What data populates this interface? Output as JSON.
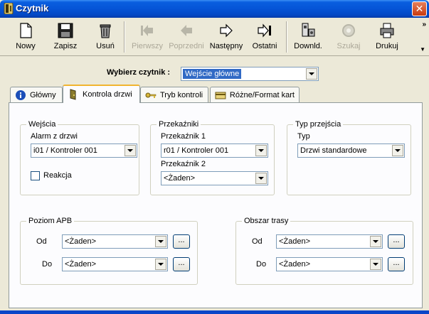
{
  "window": {
    "title": "Czytnik",
    "close_glyph": "✕"
  },
  "toolbar": {
    "buttons": [
      {
        "label": "Nowy",
        "icon": "new-document-icon",
        "enabled": true
      },
      {
        "label": "Zapisz",
        "icon": "floppy-disk-icon",
        "enabled": true
      },
      {
        "label": "Usuń",
        "icon": "trash-can-icon",
        "enabled": true
      },
      {
        "label": "Pierwszy",
        "icon": "first-arrow-icon",
        "enabled": false
      },
      {
        "label": "Poprzedni",
        "icon": "previous-arrow-icon",
        "enabled": false
      },
      {
        "label": "Następny",
        "icon": "next-arrow-icon",
        "enabled": true
      },
      {
        "label": "Ostatni",
        "icon": "last-arrow-icon",
        "enabled": true
      },
      {
        "label": "Downld.",
        "icon": "download-device-icon",
        "enabled": true
      },
      {
        "label": "Szukaj",
        "icon": "search-icon",
        "enabled": false
      },
      {
        "label": "Drukuj",
        "icon": "printer-icon",
        "enabled": true
      }
    ],
    "overflow_glyph": "»",
    "dropdown_glyph": "▼"
  },
  "reader_select": {
    "label": "Wybierz czytnik :",
    "value": "Wejście główne"
  },
  "tabs": [
    {
      "label": "Główny",
      "icon": "info-icon",
      "active": false
    },
    {
      "label": "Kontrola drzwi",
      "icon": "door-icon",
      "active": true
    },
    {
      "label": "Tryb kontroli",
      "icon": "key-icon",
      "active": false
    },
    {
      "label": "Różne/Format kart",
      "icon": "card-reader-icon",
      "active": false
    }
  ],
  "inputs_group": {
    "title": "Wejścia",
    "alarm_label": "Alarm z drzwi",
    "alarm_value": "i01 / Kontroler 001",
    "reaction_label": "Reakcja",
    "reaction_checked": false
  },
  "relays_group": {
    "title": "Przekaźniki",
    "relay1_label": "Przekaźnik 1",
    "relay1_value": "r01 / Kontroler 001",
    "relay2_label": "Przekaźnik 2",
    "relay2_value": "<Żaden>"
  },
  "passage_group": {
    "title": "Typ przejścia",
    "type_label": "Typ",
    "type_value": "Drzwi standardowe"
  },
  "apb_group": {
    "title": "Poziom APB",
    "from_label": "Od",
    "from_value": "<Żaden>",
    "to_label": "Do",
    "to_value": "<Żaden>",
    "browse_label": "..."
  },
  "route_group": {
    "title": "Obszar trasy",
    "from_label": "Od",
    "from_value": "<Żaden>",
    "to_label": "Do",
    "to_value": "<Żaden>",
    "browse_label": "..."
  }
}
